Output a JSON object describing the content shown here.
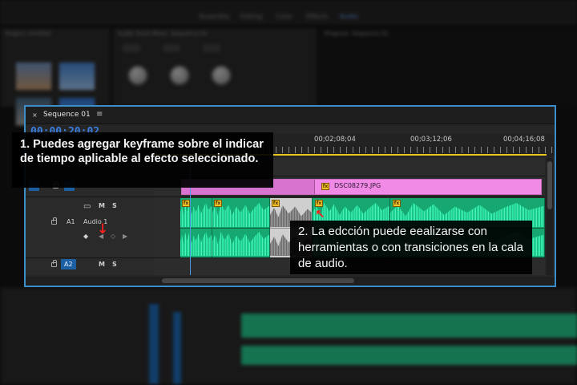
{
  "workspace_tabs": [
    "Assembly",
    "Editing",
    "Color",
    "Effects",
    "Audio"
  ],
  "panels": {
    "project_title": "Project: Untitled",
    "mixer_title": "Audio Track Mixer: Sequence 01",
    "program_title": "Program: Sequence 01"
  },
  "sequence": {
    "tab_label": "Sequence 01",
    "close_glyph": "×",
    "menu_glyph": "≡",
    "timecode": "00;00;20;02",
    "ruler_labels": [
      "00;02;08;04",
      "00;03;12;06",
      "00;04;16;08"
    ]
  },
  "tracks": {
    "video": {
      "clip_name": "DSC08279.JPG",
      "fx_badge": "fx"
    },
    "audio1": {
      "id": "A1",
      "name": "Audio 1",
      "mute": "M",
      "solo": "S"
    },
    "audio2": {
      "id": "A2",
      "mute": "M",
      "solo": "S"
    }
  },
  "callouts": {
    "first": "1. Puedes agregar keyframe sobre el indicar de tiempo aplicable al efecto seleccionado.",
    "second": "2. La edcción puede eealizarse con herramientas o con transiciones en la cala de audio."
  },
  "colors": {
    "selection_border": "#3c8ec8",
    "video_clip": "#f08ae6",
    "audio_clip": "#16a870",
    "timecode": "#3a7fe0",
    "arrow": "#ff2020"
  }
}
